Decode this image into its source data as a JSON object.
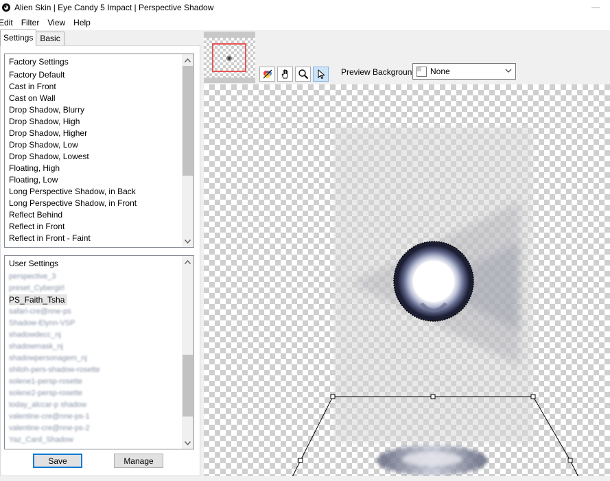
{
  "window": {
    "title": "Alien Skin | Eye Candy 5 Impact | Perspective Shadow",
    "minimize_glyph": "—"
  },
  "menu": [
    "Edit",
    "Filter",
    "View",
    "Help"
  ],
  "tabs": [
    "Settings",
    "Basic"
  ],
  "factory_settings": {
    "header": "Factory Settings",
    "items": [
      "Factory Default",
      "Cast in Front",
      "Cast on Wall",
      "Drop Shadow, Blurry",
      "Drop Shadow, High",
      "Drop Shadow, Higher",
      "Drop Shadow, Low",
      "Drop Shadow, Lowest",
      "Floating, High",
      "Floating, Low",
      "Long Perspective Shadow, in Back",
      "Long Perspective Shadow, in Front",
      "Reflect Behind",
      "Reflect in Front",
      "Reflect in Front - Faint"
    ]
  },
  "user_settings": {
    "header": "User Settings",
    "items": [
      "perspective_3",
      "preset_Cybergirl",
      "PS_Faith_Tsha",
      "safari-cre@nne-ps",
      "Shadow-Elynn-VSP",
      "shadowdecc_nj",
      "shadowmask_nj",
      "shadowpersonagem_nj",
      "shiloh-pers-shadow-rosette",
      "solene1-persp-rosette",
      "solene2-persp-rosette",
      "today_alccar-p shadow",
      "valentine-cre@nne-ps-1",
      "valentine-cre@nne-ps-2",
      "Yaz_Card_Shadow"
    ],
    "selected": "PS_Faith_Tsha"
  },
  "buttons": {
    "save": "Save",
    "manage": "Manage"
  },
  "preview": {
    "label": "Preview Background:",
    "value": "None"
  },
  "icons": {
    "app": "alien-skin-icon",
    "tools": [
      "color-swatch-icon",
      "hand-icon",
      "zoom-icon",
      "pointer-icon"
    ]
  }
}
